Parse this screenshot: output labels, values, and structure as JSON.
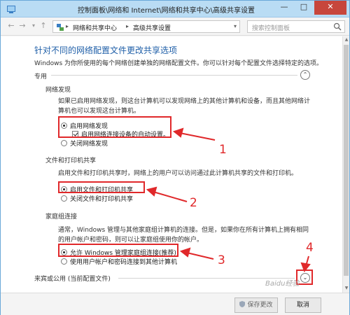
{
  "window": {
    "title": "控制面板\\网络和 Internet\\网络和共享中心\\高级共享设置"
  },
  "address": {
    "breadcrumbs": [
      "网络和共享中心",
      "高级共享设置"
    ],
    "search_placeholder": "搜索控制面板"
  },
  "content": {
    "heading": "针对不同的网络配置文件更改共享选项",
    "subtitle": "Windows 为你所使用的每个网络创建单独的网络配置文件。你可以针对每个配置文件选择特定的选项。",
    "profile_private": "专用",
    "network_discovery": {
      "title": "网络发现",
      "description": "如果已启用网络发现，则这台计算机可以发现网络上的其他计算机和设备，而且其他网络计算机也可以发现这台计算机。",
      "option_on": "启用网络发现",
      "option_auto": "启用网络连接设备的自动设置。",
      "option_off": "关闭网络发现"
    },
    "file_sharing": {
      "title": "文件和打印机共享",
      "description": "启用文件和打印机共享时，网络上的用户可以访问通过此计算机共享的文件和打印机。",
      "option_on": "启用文件和打印机共享",
      "option_off": "关闭文件和打印机共享"
    },
    "homegroup": {
      "title": "家庭组连接",
      "description": "通常，Windows 管理与其他家庭组计算机的连接。但是，如果你在所有计算机上拥有相同的用户帐户和密码，则可以让家庭组使用你的帐户。",
      "option_allow": "允许 Windows 管理家庭组连接(推荐)",
      "option_user": "使用用户帐户和密码连接到其他计算机"
    },
    "profile_guest": "来宾或公用 (当前配置文件)"
  },
  "annotations": {
    "labels": [
      "1",
      "2",
      "3",
      "4"
    ],
    "color": "#e0282a"
  },
  "footer": {
    "save_label": "保存更改",
    "cancel_label": "取消"
  },
  "watermark": "Baidu经验"
}
